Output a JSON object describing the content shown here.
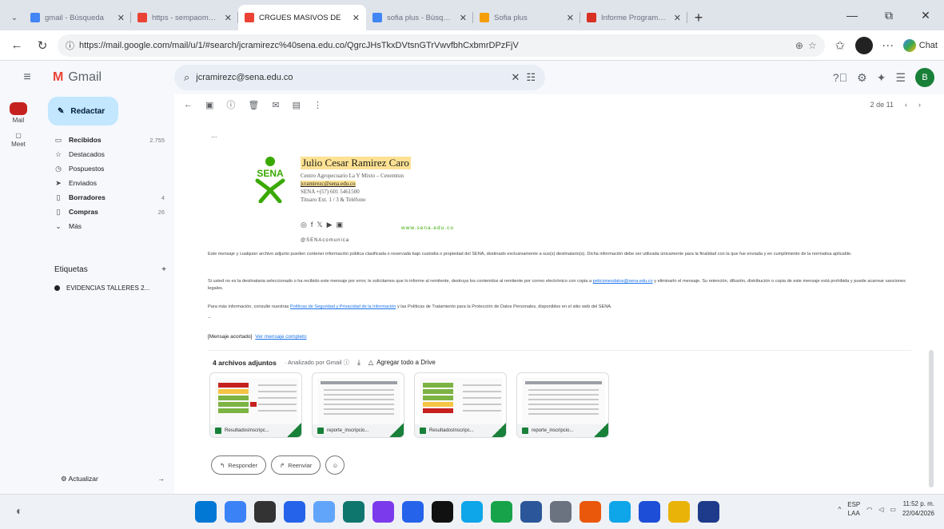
{
  "browser": {
    "tabs": [
      {
        "title": "gmail - Búsqueda",
        "fav_color": "#4285f4"
      },
      {
        "title": "https - sempaomapps",
        "fav_color": "#ea4335"
      },
      {
        "title": "CRGUES MASIVOS DE",
        "fav_color": "#ea4335",
        "active": true
      },
      {
        "title": "sofia plus - Búsqueda",
        "fav_color": "#4285f4"
      },
      {
        "title": "Sofia plus",
        "fav_color": "#f59e0b"
      },
      {
        "title": "Informe Programa de F",
        "fav_color": "#d93025"
      }
    ],
    "url": "https://mail.google.com/mail/u/1/#search/jcramirezc%40sena.edu.co/QgrcJHsTkxDVtsnGTrVwvfbhCxbmrDPzFjV",
    "chat_label": "Chat"
  },
  "gmail": {
    "app_name": "Gmail",
    "search_query": "jcramirezc@sena.edu.co",
    "avatar_letter": "B",
    "rail": [
      {
        "label": "Mail"
      },
      {
        "label": "Meet"
      }
    ],
    "compose_label": "Redactar",
    "nav": [
      {
        "icon": "inbox-icon",
        "glyph": "▭",
        "label": "Recibidos",
        "count": "2.755",
        "bold": true
      },
      {
        "icon": "star-icon",
        "glyph": "☆",
        "label": "Destacados",
        "count": ""
      },
      {
        "icon": "clock-icon",
        "glyph": "◷",
        "label": "Pospuestos",
        "count": ""
      },
      {
        "icon": "send-icon",
        "glyph": "➤",
        "label": "Enviados",
        "count": ""
      },
      {
        "icon": "draft-icon",
        "glyph": "▯",
        "label": "Borradores",
        "count": "4",
        "bold": true
      },
      {
        "icon": "cart-icon",
        "glyph": "▯",
        "label": "Compras",
        "count": "26",
        "bold": true
      },
      {
        "icon": "chevron-down-icon",
        "glyph": "⌄",
        "label": "Más",
        "count": ""
      }
    ],
    "labels_title": "Etiquetas",
    "labels": [
      {
        "label": "EVIDENCIAS TALLERES 2..."
      }
    ],
    "update_label": "Actualizar",
    "pagination": "2 de 11"
  },
  "email": {
    "ellipsis": "...",
    "signature": {
      "logo_text": "SENA",
      "name": "Julio Cesar Ramirez Caro",
      "lines": [
        "Centro Agropecuario La Y Mixto – Cenemtun",
        "jcramirezc@sena.edu.co",
        "SENA +(57) 601 5461500",
        "Tituaro Ext. 1 / 3 & Teléfono"
      ],
      "social": [
        "◎",
        "f",
        "𝕏",
        "▶",
        "▣"
      ],
      "web": "www.sena.edu.co",
      "handle": "@SENAcomunica"
    },
    "paragraphs": [
      {
        "text": "Este mensaje y cualquier archivo adjunto pueden contener información pública clasificada o reservada bajo custodia o propiedad del SENA, destinado exclusivamente a sus(s) destinatario(s). Dicha información debe ser utilizada únicamente para la finalidad con la que fue enviada y en cumplimiento de la normativa aplicable.",
        "link": "",
        "tail": ""
      },
      {
        "text": "Si usted no es la destinataria seleccionado o ha recibido este mensaje por error, le solicitamos que lo informe al remitente, destruya los contenidos al remitente por correo electrónico con copia a ",
        "link": "peticionesdatos@sena.edu.co",
        "tail": " y eliminarlo el mensaje. Su retención, difusión, distribución o copia de este mensaje está prohibida y puede acarrear sanciones legales."
      },
      {
        "text": "Para más información, consulte nuestras ",
        "link": "Políticas de Seguridad y Privacidad de la Información",
        "tail": " y las Políticas de Tratamiento para la Protección de Datos Personales, disponibles en el sitio web del SENA."
      }
    ],
    "dash": "--",
    "message_note_label": "[Mensaje acortado]",
    "message_note_link": "Ver mensaje completo",
    "attachments_title": "4 archivos adjuntos",
    "attachments_scan": "· Analizado por Gmail ⓘ",
    "add_drive_label": "Agregar todo a Drive",
    "attachments": [
      {
        "name": "ResultadosInscripc..."
      },
      {
        "name": "reporte_inscripcio..."
      },
      {
        "name": "ResultadosInscripc..."
      },
      {
        "name": "reporte_inscripcio..."
      }
    ],
    "reply_label": "Responder",
    "forward_label": "Reenviar"
  },
  "taskbar": {
    "lang1": "ESP",
    "lang2": "LAA",
    "time": "11:52 p. m.",
    "date": "22/04/2026",
    "app_colors": [
      "#0078d4",
      "#3b82f6",
      "#333333",
      "#2563eb",
      "#60a5fa",
      "#0f766e",
      "#7c3aed",
      "#2563eb",
      "#111111",
      "#0ea5e9",
      "#16a34a",
      "#2b579a",
      "#6b7280",
      "#ea580c",
      "#0ea5e9",
      "#1d4ed8",
      "#eab308",
      "#1e3a8a"
    ]
  }
}
